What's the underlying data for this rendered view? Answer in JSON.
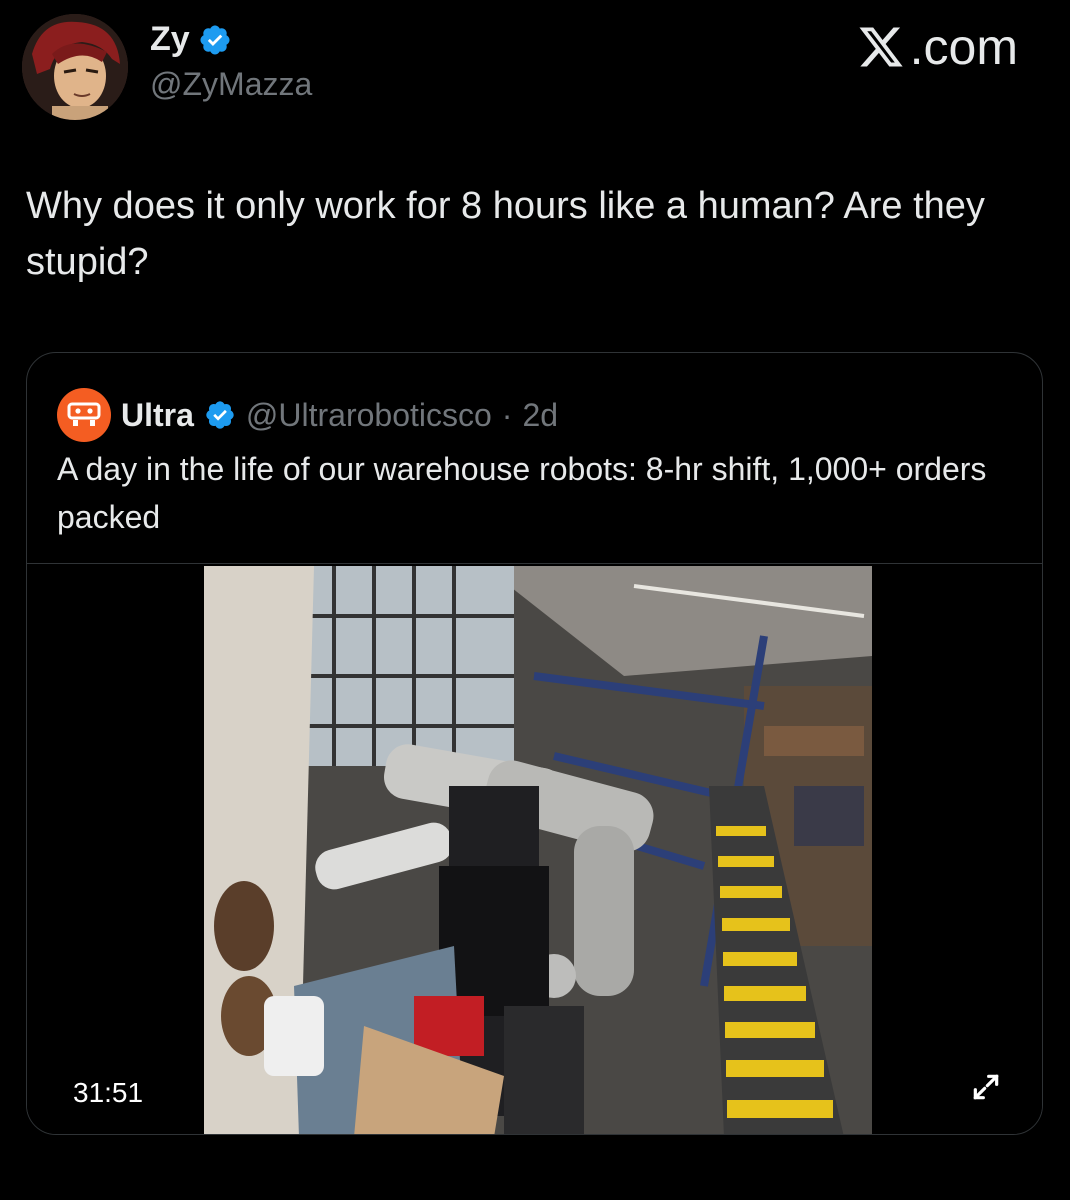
{
  "author": {
    "display_name": "Zy",
    "handle": "@ZyMazza",
    "verified": true,
    "avatar_icon": "anime-character-avatar"
  },
  "site": {
    "logo_icon": "x-logo-icon",
    "suffix": ".com"
  },
  "tweet": {
    "text": "Why does it only work for 8 hours like a human? Are they stupid?"
  },
  "quote": {
    "display_name": "Ultra",
    "handle": "@Ultraroboticsco",
    "separator": " · ",
    "age": "2d",
    "verified": true,
    "text": "A day in the life of our warehouse robots: 8-hr shift, 1,000+ orders packed",
    "brand_color": "#f45d22",
    "media": {
      "type": "video",
      "duration": "31:51",
      "expand_icon": "expand-icon"
    }
  },
  "colors": {
    "background": "#000000",
    "text_primary": "#e7e9ea",
    "text_secondary": "#71767b",
    "verified_blue": "#1d9bf0",
    "border": "#2f3336"
  }
}
